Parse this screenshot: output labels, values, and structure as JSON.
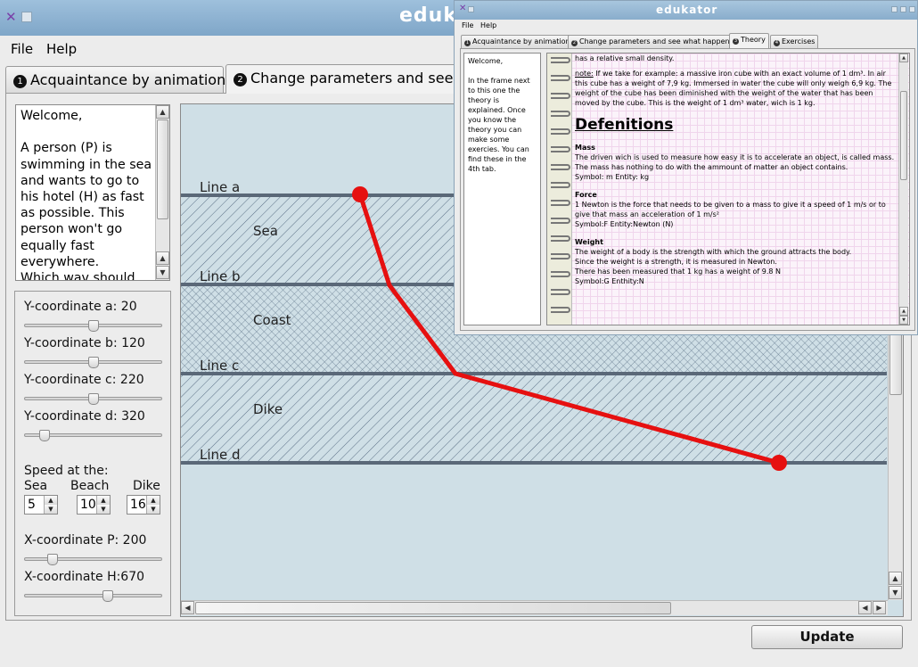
{
  "main_window": {
    "title": "edukator",
    "menu": {
      "file": "File",
      "help": "Help"
    },
    "tabs": [
      {
        "num": "1",
        "label": "Acquaintance by animation"
      },
      {
        "num": "2",
        "label": "Change parameters and see wh"
      }
    ],
    "welcome_text": "Welcome,\n\nA person (P) is swimming in the sea and wants to go to his hotel (H) as fast as possible. This person won't go equally fast everywhere.\nWhich wav should he",
    "controls": {
      "y_a": "Y-coordinate a: 20",
      "y_b": "Y-coordinate b: 120",
      "y_c": "Y-coordinate c: 220",
      "y_d": "Y-coordinate d: 320",
      "speed_label": "Speed at the:",
      "speed_sea_label": "Sea",
      "speed_beach_label": "Beach",
      "speed_dike_label": "Dike",
      "speed_sea": "5",
      "speed_beach": "10",
      "speed_dike": "16",
      "x_p": "X-coordinate P: 200",
      "x_h": "X-coordinate H:670"
    },
    "canvas": {
      "line_a": "Line a",
      "line_b": "Line b",
      "line_c": "Line c",
      "line_d": "Line d",
      "zone_sea": "Sea",
      "zone_coast": "Coast",
      "zone_dike": "Dike",
      "colors": {
        "background": "#cfdfe6",
        "line": "#5a6878",
        "path": "#e61010",
        "hatch": "#5a6f85"
      }
    },
    "update_button": "Update"
  },
  "overlay_window": {
    "title": "edukator",
    "menu": {
      "file": "File",
      "help": "Help"
    },
    "tabs": [
      {
        "num": "1",
        "label": "Acquaintance by animation"
      },
      {
        "num": "2",
        "label": "Change parameters and see what happens"
      },
      {
        "num": "3",
        "label": "Theory"
      },
      {
        "num": "4",
        "label": "Exercises"
      }
    ],
    "welcome_text": "Welcome,\n\nIn the frame next to this one the theory is explained. Once you know the theory you can make some exercies. You can find these in the 4th tab.",
    "doc": {
      "intro": "has a relative small density.",
      "note_label": "note:",
      "note": " If we take for example: a massive iron cube with an exact volume of 1 dm³. In air this cube has a weight of 7,9 kg. Immersed in water the cube will only weigh 6,9 kg. The weight of the cube has been diminished with the weight of the water that has been moved by the cube. This is the weight of 1 dm³ water, wich is 1 kg.",
      "heading": "Defenitions",
      "mass_title": "Mass",
      "mass_1": "The driven wich is used to measure how easy it is to accelerate an object, is called mass.",
      "mass_2": "The mass has nothing to do with the ammount of matter an object contains.",
      "mass_3": "Symbol: m Entity: kg",
      "force_title": "Force",
      "force_1": "1 Newton is the force that needs to be given to a mass to give it a speed of 1 m/s or to give that mass an acceleration of 1 m/s²",
      "force_2": "Symbol:F Entity:Newton (N)",
      "weight_title": "Weight",
      "weight_1": "The weight of a body is the strength with which the ground attracts the body.",
      "weight_2": "Since the weight is a strength, it is measured in Newton.",
      "weight_3": "There has been measured that 1 kg has a weight of 9.8 N",
      "weight_4": "Symbol:G Enthity:N"
    }
  }
}
